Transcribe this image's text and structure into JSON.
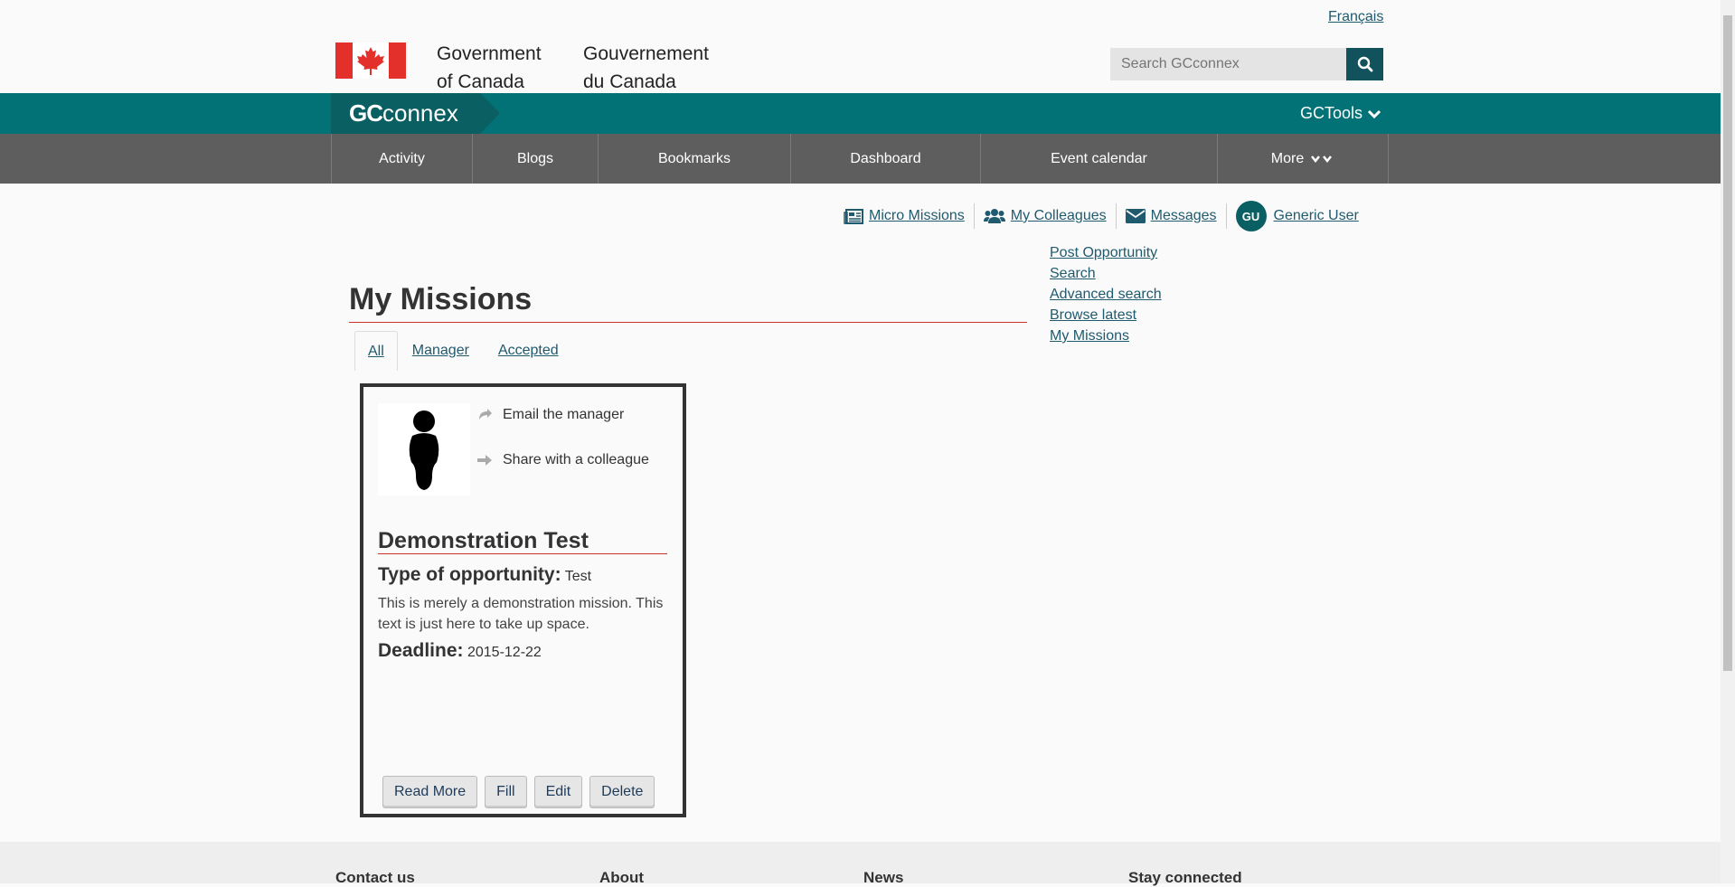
{
  "header": {
    "language_link": "Français",
    "wordmark_en_line1": "Government",
    "wordmark_en_line2": "of Canada",
    "wordmark_fr_line1": "Gouvernement",
    "wordmark_fr_line2": "du Canada",
    "search_placeholder": "Search GCconnex"
  },
  "brandbar": {
    "brand_gc": "GC",
    "brand_rest": "connex",
    "gctools_label": "GCTools"
  },
  "menu": {
    "items": [
      "Activity",
      "Blogs",
      "Bookmarks",
      "Dashboard",
      "Event calendar",
      "More"
    ]
  },
  "usernav": {
    "micro_missions": "Micro Missions",
    "my_colleagues": "My Colleagues",
    "messages": "Messages",
    "avatar_initials": "GU",
    "user_name": "Generic User"
  },
  "page": {
    "title": "My Missions",
    "tabs": [
      "All",
      "Manager",
      "Accepted"
    ],
    "active_tab": "All"
  },
  "sidebar": {
    "links": [
      "Post Opportunity",
      "Search",
      "Advanced search",
      "Browse latest",
      "My Missions"
    ]
  },
  "card": {
    "action_email": "Email the manager",
    "action_share": "Share with a colleague",
    "title": "Demonstration Test",
    "type_label": "Type of opportunity:",
    "type_value": "Test",
    "description": "This is merely a demonstration mission. This text is just here to take up space.",
    "deadline_label": "Deadline:",
    "deadline_value": "2015-12-22",
    "buttons": [
      "Read More",
      "Fill",
      "Edit",
      "Delete"
    ]
  },
  "footer": {
    "columns": [
      "Contact us",
      "About",
      "News",
      "Stay connected"
    ]
  },
  "colors": {
    "teal_bar": "#037277",
    "menu_bar": "#5e5e5e",
    "accent_red": "#c9352b",
    "link": "#1f5a6e"
  }
}
